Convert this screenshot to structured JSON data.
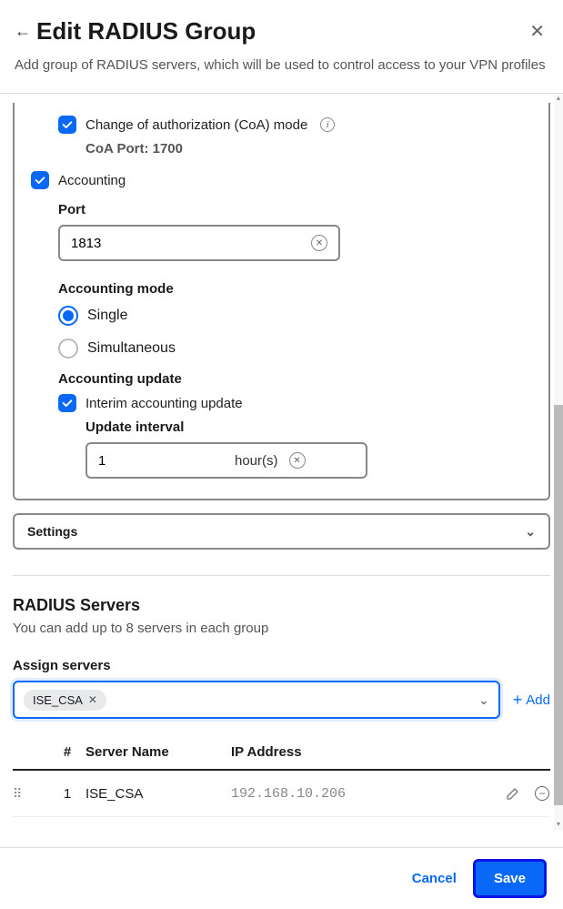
{
  "header": {
    "title": "Edit RADIUS Group",
    "subtitle": "Add group of RADIUS servers, which will be used to control access to your VPN profiles"
  },
  "coa": {
    "label": "Change of authorization (CoA) mode",
    "port_label": "CoA Port: 1700"
  },
  "accounting": {
    "label": "Accounting",
    "port_label": "Port",
    "port_value": "1813",
    "mode_label": "Accounting mode",
    "mode_single": "Single",
    "mode_simultaneous": "Simultaneous",
    "update_label": "Accounting update",
    "interim_label": "Interim accounting update",
    "interval_label": "Update interval",
    "interval_value": "1",
    "interval_unit": "hour(s)"
  },
  "settings_label": "Settings",
  "servers": {
    "title": "RADIUS Servers",
    "desc": "You can add up to 8 servers in each group",
    "assign_label": "Assign servers",
    "chip": "ISE_CSA",
    "add_label": "Add",
    "columns": {
      "num": "#",
      "name": "Server Name",
      "ip": "IP Address"
    },
    "rows": [
      {
        "num": "1",
        "name": "ISE_CSA",
        "ip": "192.168.10.206"
      }
    ]
  },
  "footer": {
    "cancel": "Cancel",
    "save": "Save"
  }
}
